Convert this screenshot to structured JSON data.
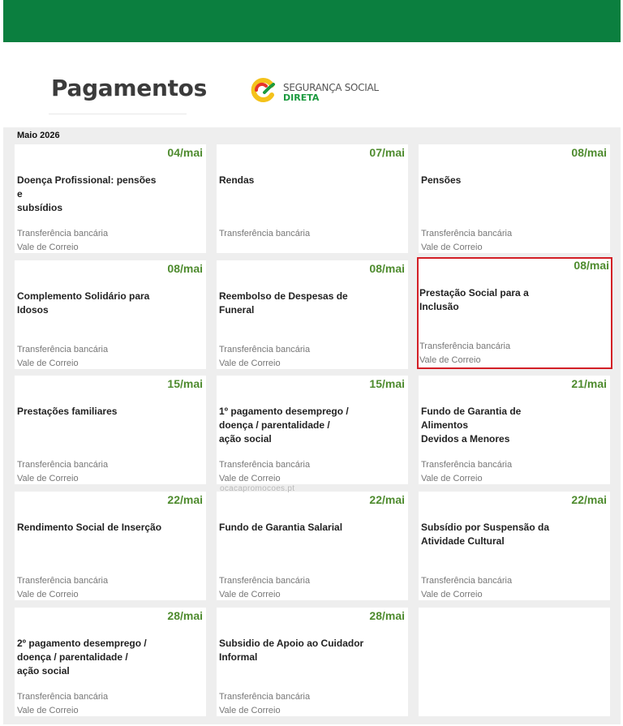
{
  "header": {
    "title": "Pagamentos",
    "logo_line1": "SEGURANÇA SOCIAL",
    "logo_line2": "DIRETA",
    "brand_color": "#0b7f3f"
  },
  "calendar": {
    "month": "Maio 2026",
    "watermark": "ocacapromocoes.pt",
    "highlight_color": "#d31f26",
    "date_color": "#4e8b2e",
    "cards": [
      {
        "date": "04/mai",
        "name": "Doença Profissional: pensões e\nsubsídios",
        "method1": "Transferência bancária",
        "method2": "Vale de Correio"
      },
      {
        "date": "07/mai",
        "name": "Rendas",
        "method1": "Transferência bancária",
        "method2": ""
      },
      {
        "date": "08/mai",
        "name": "Pensões",
        "method1": "Transferência bancária",
        "method2": "Vale de Correio"
      },
      {
        "date": "08/mai",
        "name": "Complemento Solidário para\nIdosos",
        "method1": "Transferência bancária",
        "method2": "Vale de Correio"
      },
      {
        "date": "08/mai",
        "name": "Reembolso de Despesas de\nFuneral",
        "method1": "Transferência bancária",
        "method2": "Vale de Correio"
      },
      {
        "date": "08/mai",
        "name": "Prestação Social para a Inclusão",
        "method1": "Transferência bancária",
        "method2": "Vale de Correio",
        "highlighted": true
      },
      {
        "date": "15/mai",
        "name": "Prestações familiares",
        "method1": "Transferência bancária",
        "method2": "Vale de Correio"
      },
      {
        "date": "15/mai",
        "name": "1º pagamento desemprego /\ndoença / parentalidade /\nação social",
        "method1": "Transferência bancária",
        "method2": "Vale de Correio"
      },
      {
        "date": "21/mai",
        "name": "Fundo de Garantia de Alimentos\n Devidos a Menores",
        "method1": "Transferência bancária",
        "method2": "Vale de Correio"
      },
      {
        "date": "22/mai",
        "name": "Rendimento Social de Inserção",
        "method1": "Transferência bancária",
        "method2": "Vale de Correio"
      },
      {
        "date": "22/mai",
        "name": "Fundo de Garantia Salarial",
        "method1": "Transferência bancária",
        "method2": "Vale de Correio"
      },
      {
        "date": "22/mai",
        "name": "Subsídio por Suspensão da\nAtividade Cultural",
        "method1": "Transferência bancária",
        "method2": "Vale de Correio"
      },
      {
        "date": "28/mai",
        "name": "2º pagamento desemprego /\ndoença / parentalidade /\nação social",
        "method1": "Transferência bancária",
        "method2": "Vale de Correio"
      },
      {
        "date": "28/mai",
        "name": "Subsidio de Apoio ao Cuidador\n Informal",
        "method1": "Transferência bancária",
        "method2": "Vale de Correio"
      }
    ]
  }
}
